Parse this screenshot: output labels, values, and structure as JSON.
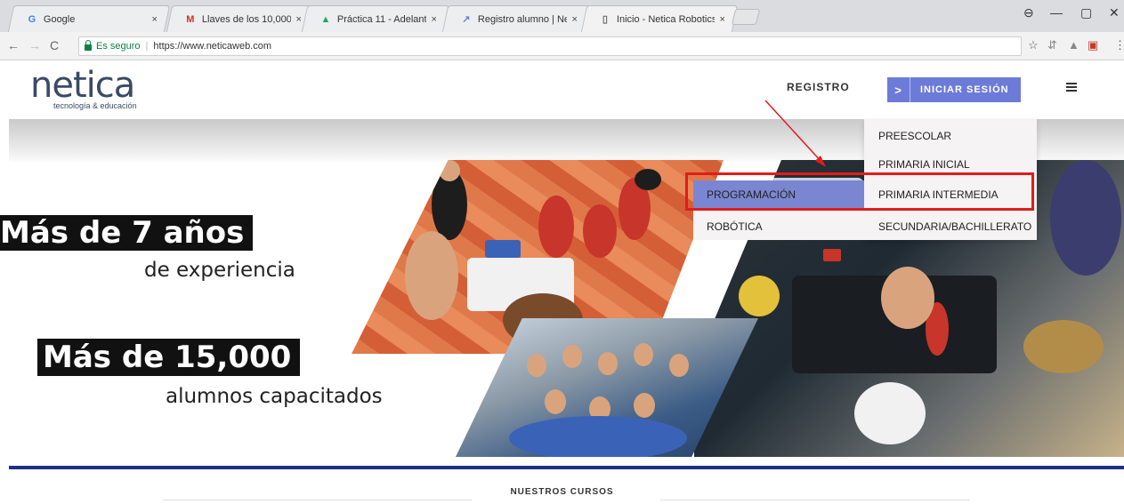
{
  "browser": {
    "tabs": [
      {
        "title": "Google",
        "favicon": "G",
        "favicon_color": "#4285f4"
      },
      {
        "title": "Llaves de los 10,000 ejem",
        "favicon": "M",
        "favicon_color": "#d93025"
      },
      {
        "title": "Práctica 11 - Adelante, at",
        "favicon": "▲",
        "favicon_color": "#1fa463"
      },
      {
        "title": "Registro alumno | Netica",
        "favicon": "↗",
        "favicon_color": "#6c7bd8"
      },
      {
        "title": "Inicio - Netica Robotics -",
        "favicon": "▯",
        "favicon_color": "#666666"
      }
    ],
    "tab_close": "×",
    "secure_label": "Es seguro",
    "url": "https://www.neticaweb.com"
  },
  "header": {
    "logo_text": "netica",
    "logo_tagline": "tecnología & educación",
    "nav_registro": "REGISTRO",
    "login_chevron": ">",
    "login_label": "INICIAR SESIÓN"
  },
  "hero": {
    "headline1": "Más de 7 años",
    "subline1": "de experiencia",
    "headline2": "Más de 15,000",
    "subline2": "alumnos capacitados"
  },
  "menu": {
    "items": [
      "PREESCOLAR",
      "PRIMARIA INICIAL",
      "PRIMARIA INTERMEDIA",
      "SECUNDARIA/BACHILLERATO"
    ],
    "submenu": [
      "PROGRAMACIÓN",
      "ROBÓTICA"
    ]
  },
  "section": {
    "courses_title": "NUESTROS CURSOS"
  },
  "colors": {
    "accent": "#6c7bd8",
    "highlight_box": "#e41b1b",
    "footer_bar": "#1f2f84"
  }
}
